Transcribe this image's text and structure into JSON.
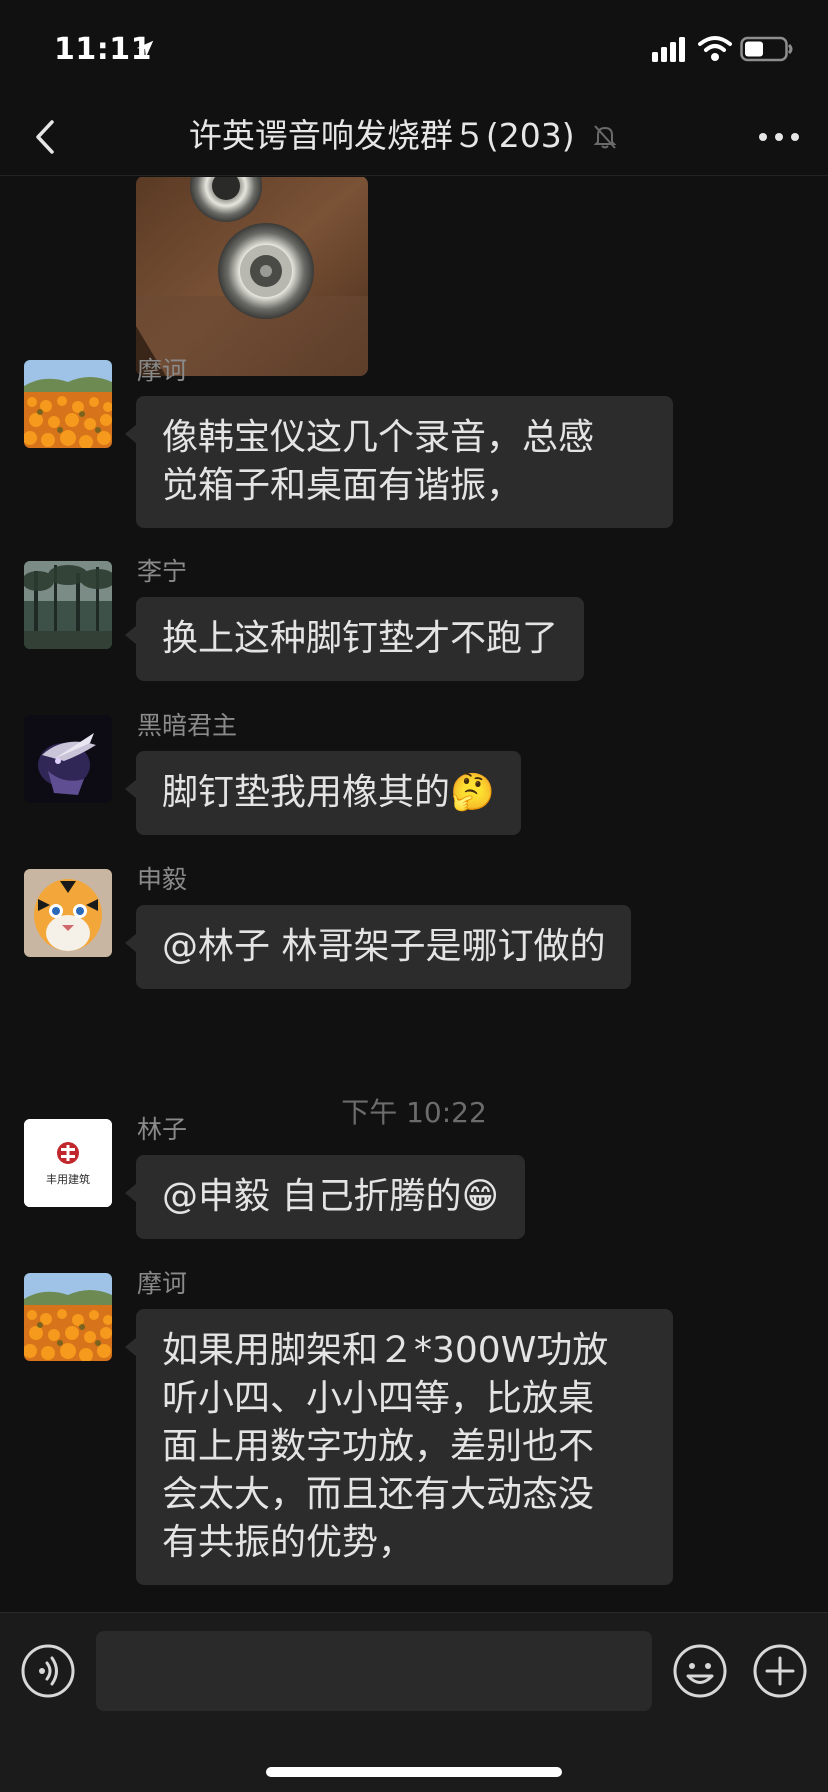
{
  "status_bar": {
    "time": "11:11"
  },
  "nav": {
    "title": "许英谔音响发烧群５(203)"
  },
  "messages": [
    {
      "sender": "摩诃",
      "text": "像韩宝仪这几个录音，总感\n觉箱子和桌面有谐振，",
      "avatar": "marigold-field"
    },
    {
      "sender": "李宁",
      "text": "换上这种脚钉垫才不跑了",
      "avatar": "forest-trees"
    },
    {
      "sender": "黑暗君主",
      "text": "脚钉垫我用橡其的",
      "emoji": "🤔",
      "avatar": "dark-lord"
    },
    {
      "sender": "申毅",
      "text": "@林子  林哥架子是哪订做的",
      "avatar": "tiger-face"
    },
    {
      "sender": "林子",
      "text": "@申毅  自己折腾的",
      "emoji": "😁",
      "avatar": "company-logo",
      "avatar_text": "丰用建筑"
    },
    {
      "sender": "摩诃",
      "text": "如果用脚架和２*300W功放\n听小四、小小四等，比放桌\n面上用数字功放，差别也不\n会太大，而且还有大动态没\n有共振的优势，",
      "avatar": "marigold-field"
    }
  ],
  "timestamp": "下午 10:22",
  "colors": {
    "background": "#111111",
    "bubble": "#2c2c2c",
    "text": "#e4e4e4",
    "sender": "#8a8a8a"
  },
  "icons": [
    "back-icon",
    "mute-icon",
    "more-icon",
    "voice-icon",
    "emoji-icon",
    "plus-icon",
    "location-icon",
    "signal-icon",
    "wifi-icon",
    "battery-icon"
  ]
}
